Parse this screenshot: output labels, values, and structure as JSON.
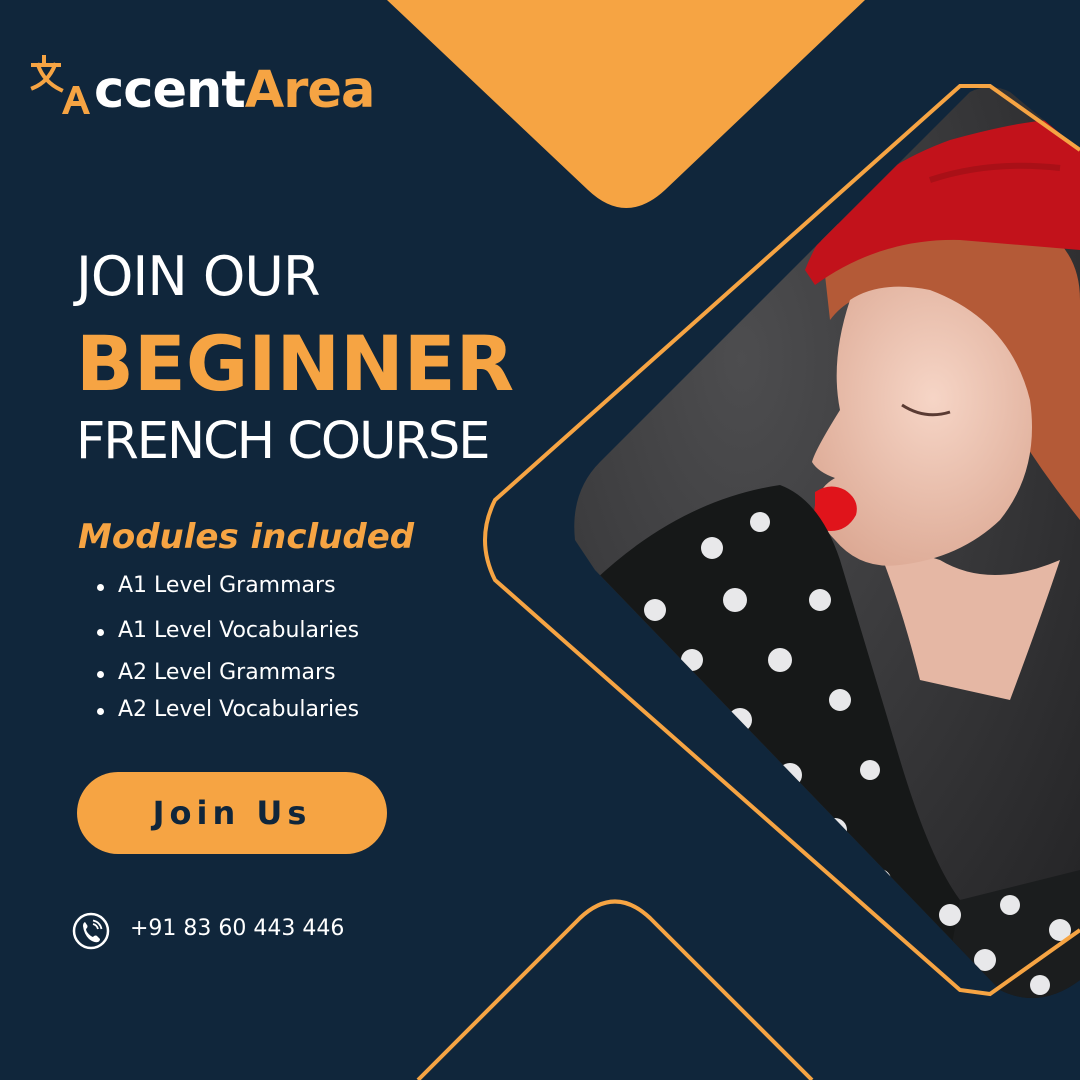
{
  "brand": {
    "logo_text_white": "ccent",
    "logo_text_orange": "Area",
    "icon": "translate-icon"
  },
  "headline": {
    "line1": "JOIN OUR",
    "line2": "BEGINNER",
    "line3": "FRENCH COURSE"
  },
  "modules": {
    "title": "Modules included",
    "items": [
      "A1 Level Grammars",
      "A1 Level Vocabularies",
      "A2 Level Grammars",
      "A2 Level Vocabularies"
    ]
  },
  "cta": {
    "label": "Join Us"
  },
  "contact": {
    "icon": "phone-icon",
    "phone": "+91 83 60 443 446"
  },
  "colors": {
    "background": "#10263b",
    "accent": "#f6a443",
    "text": "#ffffff"
  }
}
